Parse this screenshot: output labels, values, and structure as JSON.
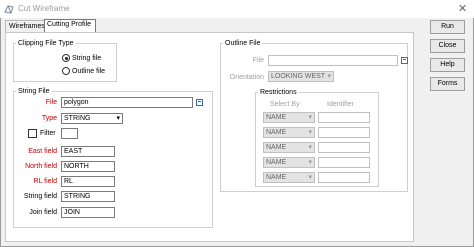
{
  "window": {
    "title": "Cut Wireframe",
    "close_glyph": "✕"
  },
  "tabs": [
    {
      "label": "Wireframes"
    },
    {
      "label": "Cutting Profile"
    }
  ],
  "clipping": {
    "title": "Clipping File Type",
    "options": [
      {
        "label": "String file",
        "selected": true
      },
      {
        "label": "Outline file",
        "selected": false
      }
    ]
  },
  "string_file": {
    "title": "String File",
    "file_label": "File",
    "file_value": "polygon",
    "type_label": "Type",
    "type_value": "STRING",
    "filter_label": "Filter",
    "east_label": "East field",
    "east_value": "EAST",
    "north_label": "North field",
    "north_value": "NORTH",
    "rl_label": "RL field",
    "rl_value": "RL",
    "string_label": "String field",
    "string_value": "STRING",
    "join_label": "Join field",
    "join_value": "JOIN"
  },
  "outline_file": {
    "title": "Outline File",
    "file_label": "File",
    "file_value": "",
    "orientation_label": "Orientation",
    "orientation_value": "LOOKING WEST",
    "restrictions": {
      "title": "Restrictions",
      "select_by_header": "Select By",
      "identifier_header": "Identifier",
      "rows": [
        {
          "select_by": "NAME",
          "identifier": ""
        },
        {
          "select_by": "NAME",
          "identifier": ""
        },
        {
          "select_by": "NAME",
          "identifier": ""
        },
        {
          "select_by": "NAME",
          "identifier": ""
        },
        {
          "select_by": "NAME",
          "identifier": ""
        }
      ]
    }
  },
  "buttons": {
    "run": "Run",
    "close": "Close",
    "help": "Help",
    "forms": "Forms"
  },
  "icons": {
    "dropdown": "▾",
    "file_browse": "file-browse-icon",
    "app": "wireframe-app-icon"
  },
  "colors": {
    "required_label": "#c00000",
    "disabled_text": "#a0a0a0",
    "icon_blue": "#2f6fb5"
  }
}
